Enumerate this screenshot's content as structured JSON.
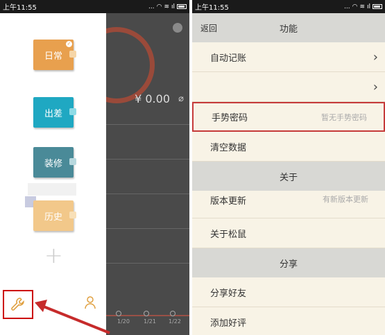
{
  "left_phone": {
    "status": {
      "time": "上午11:55",
      "signal": "...",
      "battery_icon": "battery-icon"
    },
    "books": [
      {
        "label": "日常",
        "color": "#e8a04e"
      },
      {
        "label": "出差",
        "color": "#1fa8c2"
      },
      {
        "label": "装修",
        "color": "#4a8a98"
      },
      {
        "label": "历史",
        "color": "#f2c88a"
      }
    ],
    "add_symbol": "+",
    "background": {
      "amount": "¥ 0.00",
      "dates": [
        "1/20",
        "1/21",
        "1/22"
      ]
    }
  },
  "right_phone": {
    "status": {
      "time": "上午11:55",
      "signal": "..."
    },
    "header": {
      "back": "返回",
      "title": "功能"
    },
    "rows_function": [
      {
        "label": "自动记账",
        "value": "",
        "chevron": "›"
      },
      {
        "label": "",
        "value": "",
        "chevron": "›"
      },
      {
        "label": "手势密码",
        "value": "暂无手势密码",
        "chevron": ""
      },
      {
        "label": "清空数据",
        "value": "",
        "chevron": ""
      }
    ],
    "section_about": "关于",
    "rows_about": [
      {
        "label": "版本更新",
        "value": "有新版本更新"
      },
      {
        "label": "关于松鼠",
        "value": ""
      }
    ],
    "section_share": "分享",
    "rows_share": [
      {
        "label": "分享好友",
        "value": ""
      },
      {
        "label": "添加好评",
        "value": ""
      }
    ]
  }
}
